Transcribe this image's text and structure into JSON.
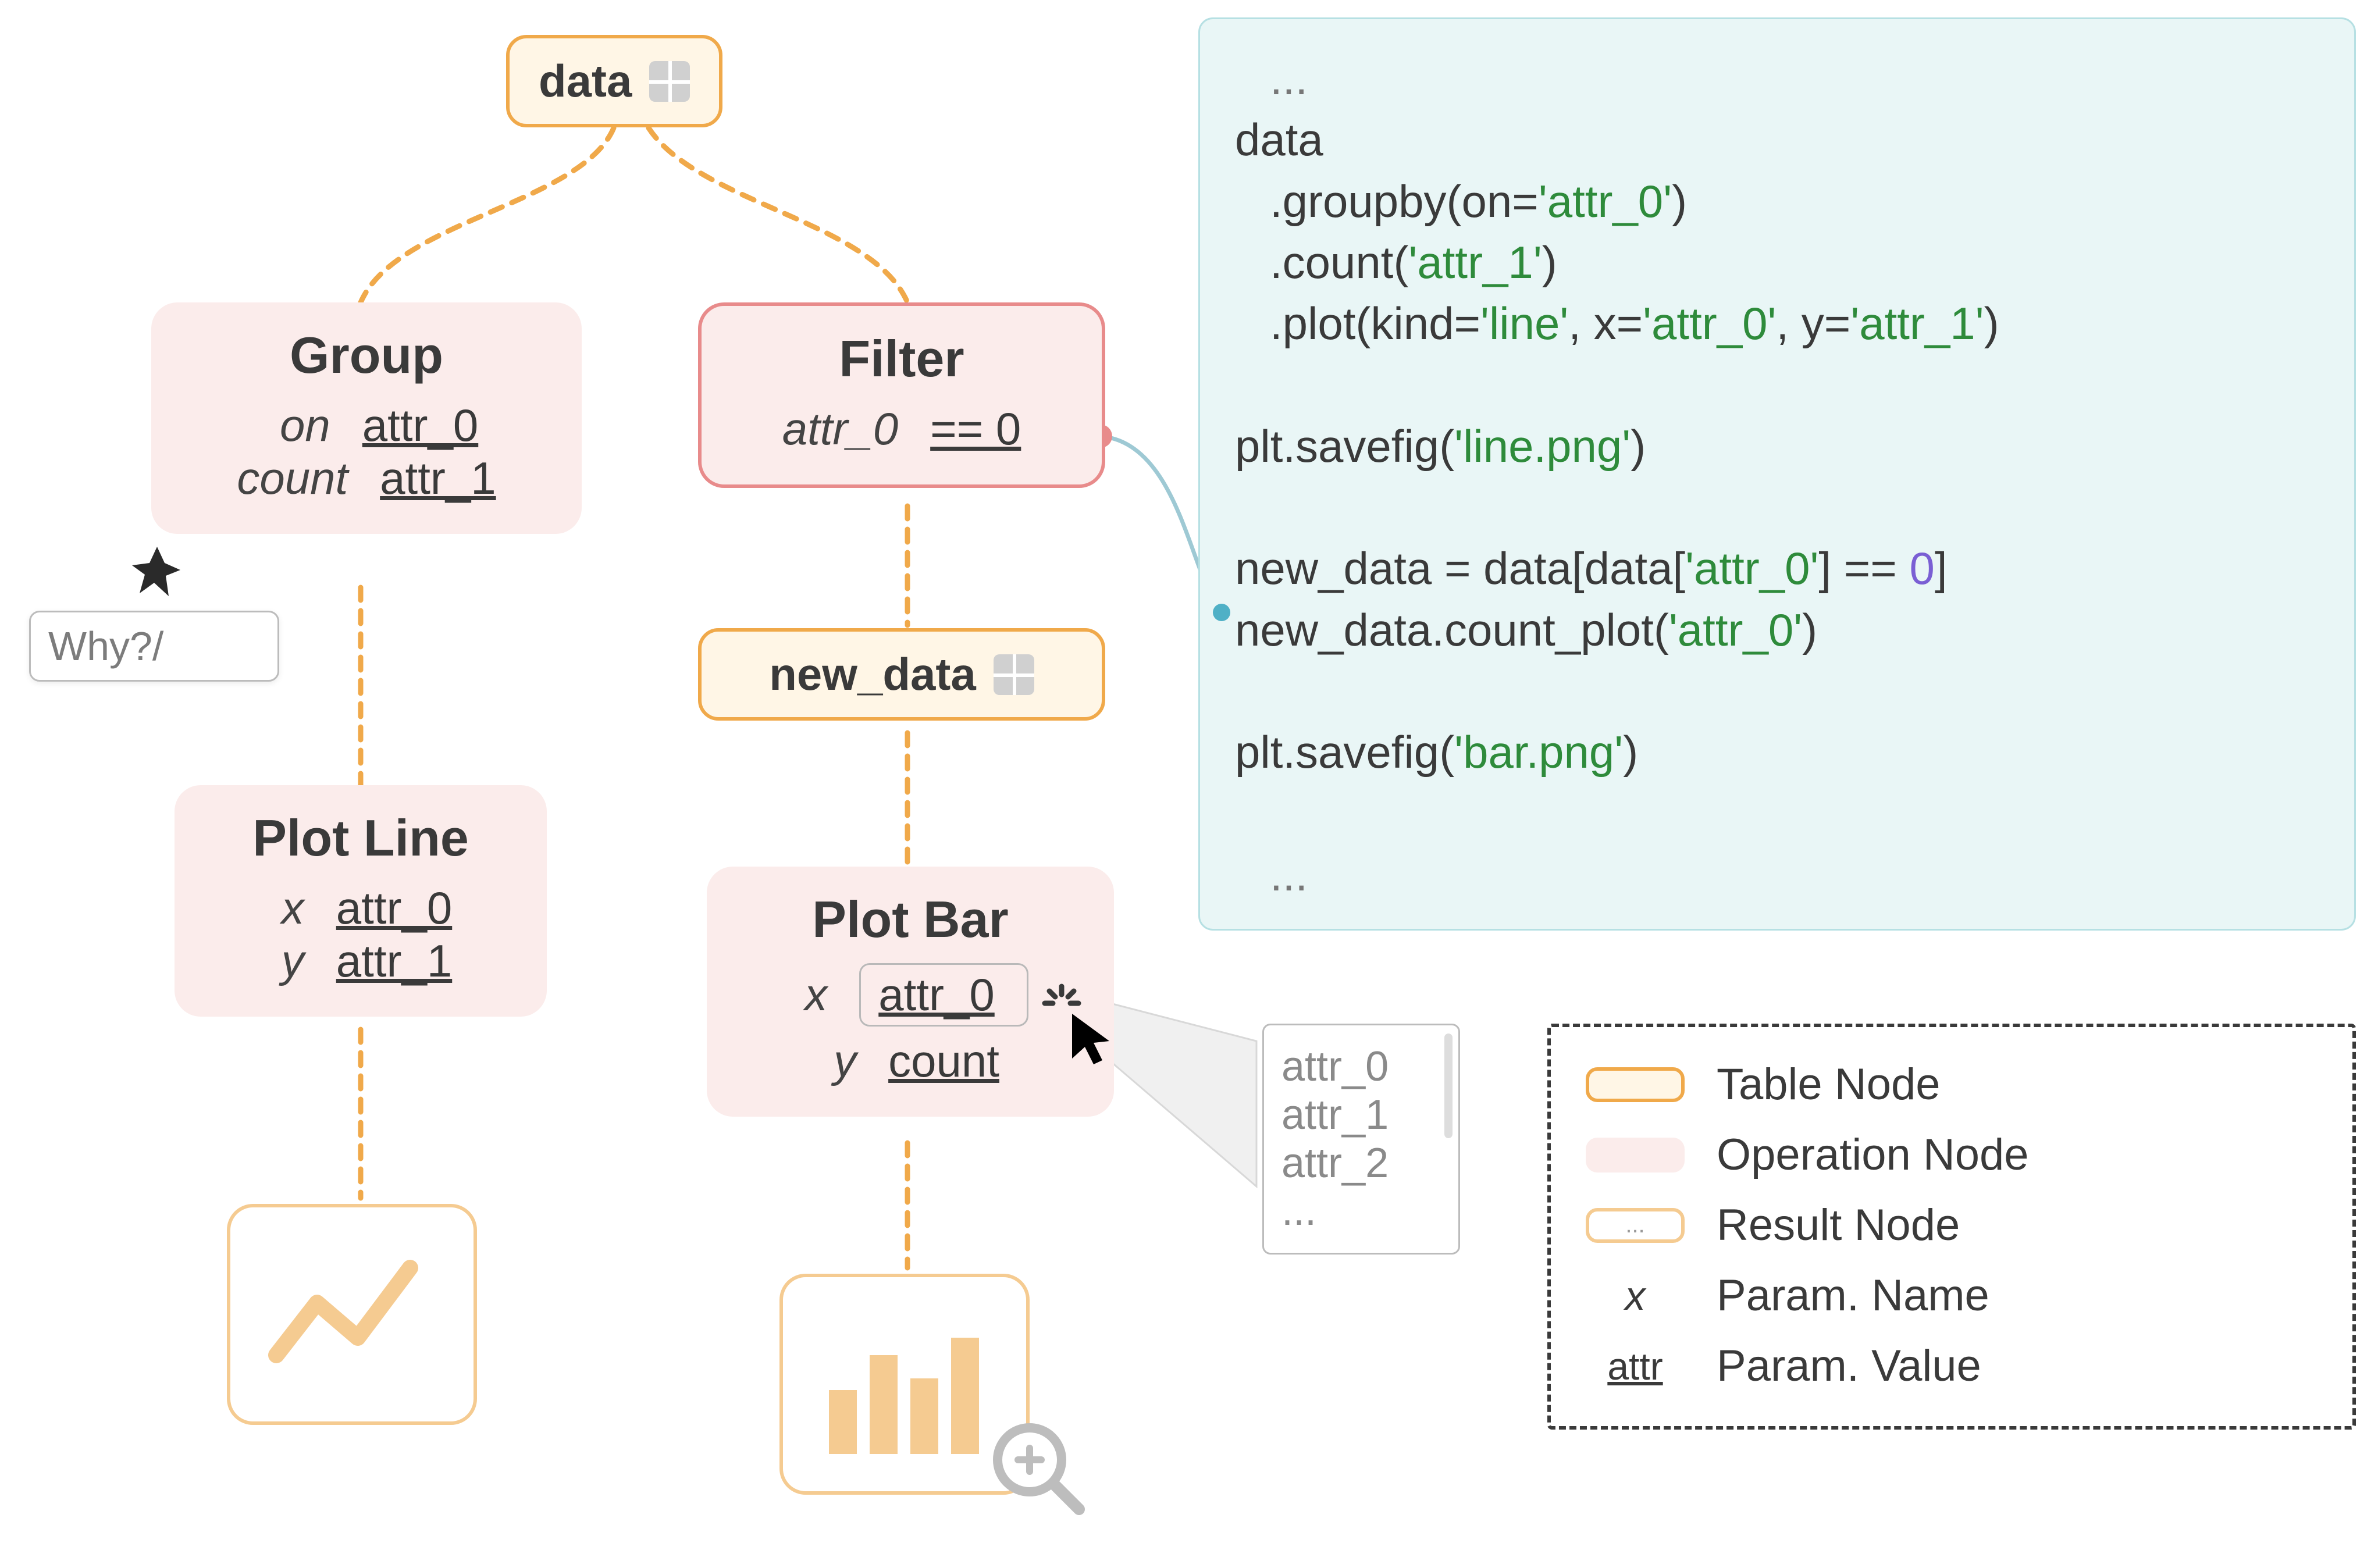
{
  "nodes": {
    "data": {
      "label": "data"
    },
    "new_data": {
      "label": "new_data"
    },
    "group": {
      "title": "Group",
      "params": [
        {
          "name": "on",
          "value": "attr_0"
        },
        {
          "name": "count",
          "value": "attr_1"
        }
      ]
    },
    "filter": {
      "title": "Filter",
      "params": [
        {
          "name": "attr_0",
          "value": "== 0"
        }
      ]
    },
    "plot_line": {
      "title": "Plot Line",
      "params": [
        {
          "name": "x",
          "value": "attr_0"
        },
        {
          "name": "y",
          "value": "attr_1"
        }
      ]
    },
    "plot_bar": {
      "title": "Plot Bar",
      "params": [
        {
          "name": "x",
          "value": "attr_0"
        },
        {
          "name": "y",
          "value": "count"
        }
      ]
    }
  },
  "why_popover": {
    "placeholder": "Why?/"
  },
  "dropdown": {
    "options": [
      "attr_0",
      "attr_1",
      "attr_2"
    ],
    "more": "..."
  },
  "code": {
    "dots": "...",
    "l1": "data",
    "l2_a": ".groupby(on=",
    "l2_b": "'attr_0'",
    "l2_c": ")",
    "l3_a": ".count(",
    "l3_b": "'attr_1'",
    "l3_c": ")",
    "l4_a": ".plot(kind=",
    "l4_b": "'line'",
    "l4_c": ", x=",
    "l4_d": "'attr_0'",
    "l4_e": ", y=",
    "l4_f": "'attr_1'",
    "l4_g": ")",
    "l5_a": "plt.savefig(",
    "l5_b": "'line.png'",
    "l5_c": ")",
    "l6_a": "new_data = data[data[",
    "l6_b": "'attr_0'",
    "l6_c": "] == ",
    "l6_d": "0",
    "l6_e": "]",
    "l7_a": "new_data.count_plot(",
    "l7_b": "'attr_0'",
    "l7_c": ")",
    "l8_a": "plt.savefig(",
    "l8_b": "'bar.png'",
    "l8_c": ")"
  },
  "legend": {
    "table": "Table Node",
    "op": "Operation Node",
    "result": "Result Node",
    "pname": "Param. Name",
    "pvalue": "Param. Value",
    "x_sample": "x",
    "attr_sample": "attr",
    "res_dots": "..."
  }
}
